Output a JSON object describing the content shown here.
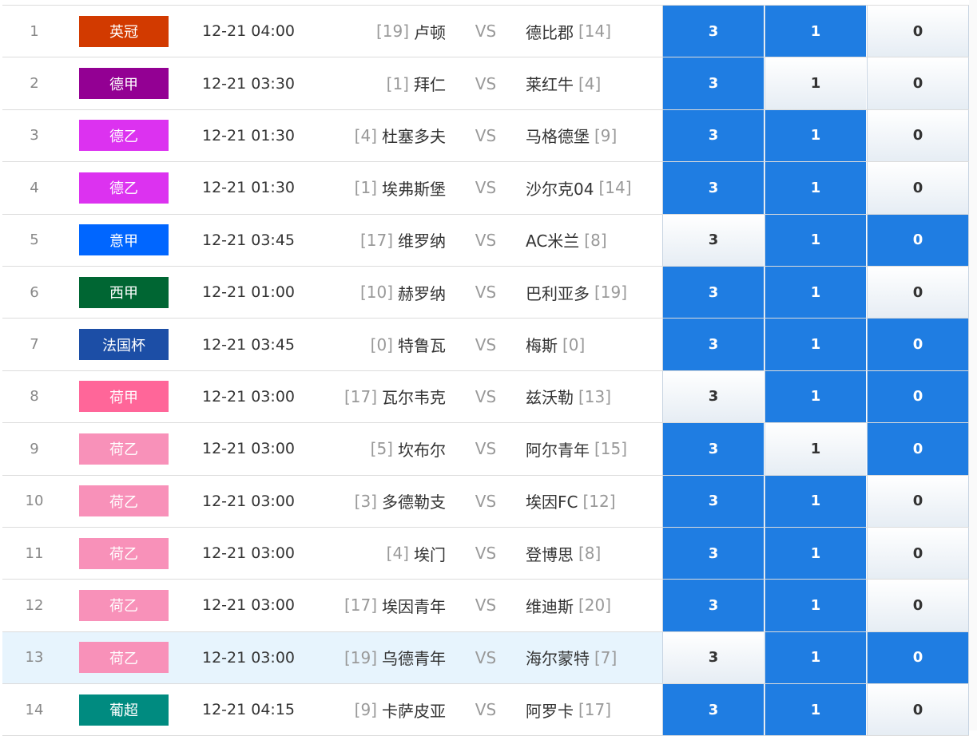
{
  "option_labels": [
    "3",
    "1",
    "0"
  ],
  "vs_label": "VS",
  "colors": {
    "selected": "#1f7de2",
    "unselected": "#eef3f8",
    "highlight_row": "#e7f4fd"
  },
  "matches": [
    {
      "num": "1",
      "league": "英冠",
      "league_color": "#d23a00",
      "time": "12-21 04:00",
      "home_rank": "[19]",
      "home": "卢顿",
      "away": "德比郡",
      "away_rank": "[14]",
      "selected": [
        true,
        true,
        false
      ]
    },
    {
      "num": "2",
      "league": "德甲",
      "league_color": "#930093",
      "time": "12-21 03:30",
      "home_rank": "[1]",
      "home": "拜仁",
      "away": "莱红牛",
      "away_rank": "[4]",
      "selected": [
        true,
        false,
        false
      ]
    },
    {
      "num": "3",
      "league": "德乙",
      "league_color": "#dc32f0",
      "time": "12-21 01:30",
      "home_rank": "[4]",
      "home": "杜塞多夫",
      "away": "马格德堡",
      "away_rank": "[9]",
      "selected": [
        true,
        true,
        false
      ]
    },
    {
      "num": "4",
      "league": "德乙",
      "league_color": "#dc32f0",
      "time": "12-21 01:30",
      "home_rank": "[1]",
      "home": "埃弗斯堡",
      "away": "沙尔克04",
      "away_rank": "[14]",
      "selected": [
        true,
        true,
        false
      ]
    },
    {
      "num": "5",
      "league": "意甲",
      "league_color": "#0066ff",
      "time": "12-21 03:45",
      "home_rank": "[17]",
      "home": "维罗纳",
      "away": "AC米兰",
      "away_rank": "[8]",
      "selected": [
        false,
        true,
        true
      ]
    },
    {
      "num": "6",
      "league": "西甲",
      "league_color": "#006633",
      "time": "12-21 01:00",
      "home_rank": "[10]",
      "home": "赫罗纳",
      "away": "巴利亚多",
      "away_rank": "[19]",
      "selected": [
        true,
        true,
        false
      ]
    },
    {
      "num": "7",
      "league": "法国杯",
      "league_color": "#1c4ea6",
      "time": "12-21 03:45",
      "home_rank": "[0]",
      "home": "特鲁瓦",
      "away": "梅斯",
      "away_rank": "[0]",
      "selected": [
        true,
        true,
        true
      ]
    },
    {
      "num": "8",
      "league": "荷甲",
      "league_color": "#ff6699",
      "time": "12-21 03:00",
      "home_rank": "[17]",
      "home": "瓦尔韦克",
      "away": "兹沃勒",
      "away_rank": "[13]",
      "selected": [
        false,
        true,
        true
      ]
    },
    {
      "num": "9",
      "league": "荷乙",
      "league_color": "#f891b9",
      "time": "12-21 03:00",
      "home_rank": "[5]",
      "home": "坎布尔",
      "away": "阿尔青年",
      "away_rank": "[15]",
      "selected": [
        true,
        false,
        true
      ]
    },
    {
      "num": "10",
      "league": "荷乙",
      "league_color": "#f891b9",
      "time": "12-21 03:00",
      "home_rank": "[3]",
      "home": "多德勒支",
      "away": "埃因FC",
      "away_rank": "[12]",
      "selected": [
        true,
        true,
        false
      ]
    },
    {
      "num": "11",
      "league": "荷乙",
      "league_color": "#f891b9",
      "time": "12-21 03:00",
      "home_rank": "[4]",
      "home": "埃门",
      "away": "登博思",
      "away_rank": "[8]",
      "selected": [
        true,
        true,
        false
      ]
    },
    {
      "num": "12",
      "league": "荷乙",
      "league_color": "#f891b9",
      "time": "12-21 03:00",
      "home_rank": "[17]",
      "home": "埃因青年",
      "away": "维迪斯",
      "away_rank": "[20]",
      "selected": [
        true,
        true,
        false
      ]
    },
    {
      "num": "13",
      "league": "荷乙",
      "league_color": "#f891b9",
      "time": "12-21 03:00",
      "home_rank": "[19]",
      "home": "乌德青年",
      "away": "海尔蒙特",
      "away_rank": "[7]",
      "selected": [
        false,
        true,
        true
      ],
      "highlight": true
    },
    {
      "num": "14",
      "league": "葡超",
      "league_color": "#008b80",
      "time": "12-21 04:15",
      "home_rank": "[9]",
      "home": "卡萨皮亚",
      "away": "阿罗卡",
      "away_rank": "[17]",
      "selected": [
        true,
        true,
        false
      ]
    }
  ]
}
